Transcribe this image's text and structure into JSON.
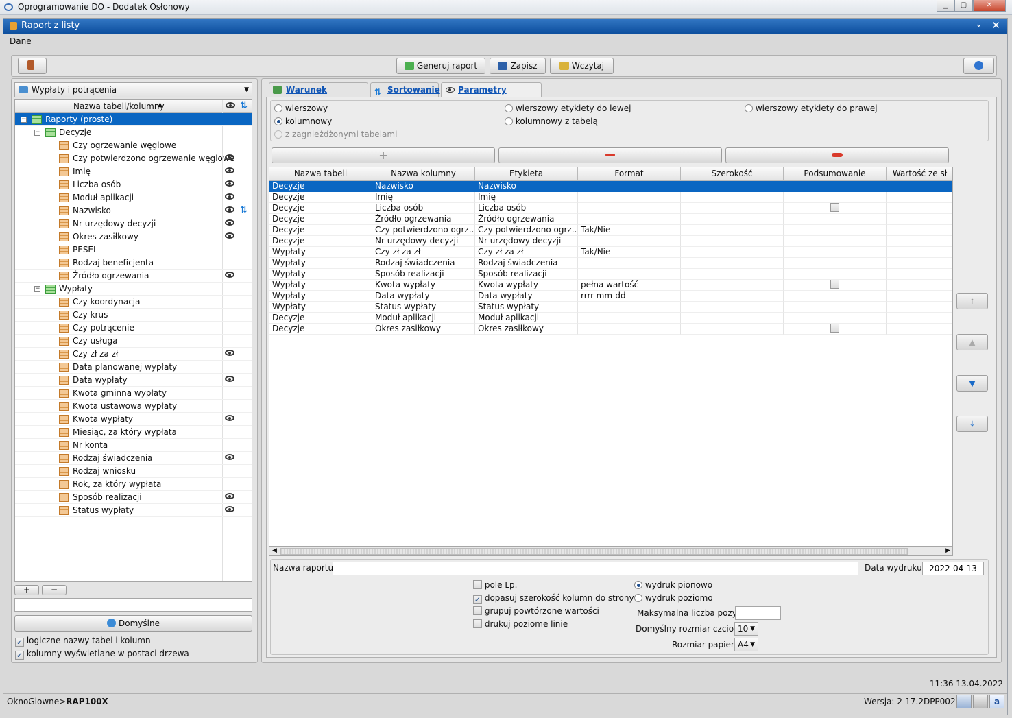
{
  "app_title": "Oprogramowanie DO - Dodatek Osłonowy",
  "window_title": "Raport z listy",
  "menu": {
    "dane": "Dane"
  },
  "toolbar": {
    "generate": "Generuj raport",
    "save": "Zapisz",
    "load": "Wczytaj"
  },
  "left": {
    "dataset": "Wypłaty i potrącenia",
    "tree_header": "Nazwa tabeli/kolumny",
    "root": "Raporty (proste)",
    "groups": [
      {
        "label": "Decyzje",
        "items": [
          {
            "label": "Czy ogrzewanie węglowe",
            "eye": false,
            "sort": false
          },
          {
            "label": "Czy potwierdzono ogrzewanie węglowe",
            "eye": true,
            "sort": false
          },
          {
            "label": "Imię",
            "eye": true,
            "sort": false
          },
          {
            "label": "Liczba osób",
            "eye": true,
            "sort": false
          },
          {
            "label": "Moduł aplikacji",
            "eye": true,
            "sort": false
          },
          {
            "label": "Nazwisko",
            "eye": true,
            "sort": true
          },
          {
            "label": "Nr urzędowy decyzji",
            "eye": true,
            "sort": false
          },
          {
            "label": "Okres zasiłkowy",
            "eye": true,
            "sort": false
          },
          {
            "label": "PESEL",
            "eye": false,
            "sort": false
          },
          {
            "label": "Rodzaj beneficjenta",
            "eye": false,
            "sort": false
          },
          {
            "label": "Źródło ogrzewania",
            "eye": true,
            "sort": false
          }
        ]
      },
      {
        "label": "Wypłaty",
        "items": [
          {
            "label": "Czy koordynacja",
            "eye": false,
            "sort": false
          },
          {
            "label": "Czy krus",
            "eye": false,
            "sort": false
          },
          {
            "label": "Czy potrącenie",
            "eye": false,
            "sort": false
          },
          {
            "label": "Czy usługa",
            "eye": false,
            "sort": false
          },
          {
            "label": "Czy zł za zł",
            "eye": true,
            "sort": false
          },
          {
            "label": "Data planowanej wypłaty",
            "eye": false,
            "sort": false
          },
          {
            "label": "Data wypłaty",
            "eye": true,
            "sort": false
          },
          {
            "label": "Kwota gminna wypłaty",
            "eye": false,
            "sort": false
          },
          {
            "label": "Kwota ustawowa wypłaty",
            "eye": false,
            "sort": false
          },
          {
            "label": "Kwota wypłaty",
            "eye": true,
            "sort": false
          },
          {
            "label": "Miesiąc, za który wypłata",
            "eye": false,
            "sort": false
          },
          {
            "label": "Nr konta",
            "eye": false,
            "sort": false
          },
          {
            "label": "Rodzaj świadczenia",
            "eye": true,
            "sort": false
          },
          {
            "label": "Rodzaj wniosku",
            "eye": false,
            "sort": false
          },
          {
            "label": "Rok, za który wypłata",
            "eye": false,
            "sort": false
          },
          {
            "label": "Sposób realizacji",
            "eye": true,
            "sort": false
          },
          {
            "label": "Status wypłaty",
            "eye": true,
            "sort": false
          }
        ]
      }
    ],
    "plus": "+",
    "minus": "−",
    "defaults_button": "Domyślne",
    "opt_logical_names": "logiczne nazwy tabel i kolumn",
    "opt_tree_columns": "kolumny wyświetlane w postaci drzewa"
  },
  "tabs": {
    "condition": "Warunek zapytania",
    "sorting": "Sortowanie",
    "params": "Parametry raportu"
  },
  "layout_options": {
    "row_plain": "wierszowy",
    "row_labels_left": "wierszowy etykiety do lewej",
    "row_labels_right": "wierszowy etykiety do prawej",
    "columnar": "kolumnowy",
    "columnar_table": "kolumnowy z tabelą",
    "nested": "z zagnieżdżonymi tabelami",
    "selected": "columnar"
  },
  "grid": {
    "headers": [
      "Nazwa tabeli",
      "Nazwa kolumny",
      "Etykieta",
      "Format",
      "Szerokość",
      "Podsumowanie",
      "Wartość ze sł"
    ],
    "rows": [
      {
        "table": "Decyzje",
        "column": "Nazwisko",
        "label": "Nazwisko",
        "format": "",
        "summary": false
      },
      {
        "table": "Decyzje",
        "column": "Imię",
        "label": "Imię",
        "format": "",
        "summary": false
      },
      {
        "table": "Decyzje",
        "column": "Liczba osób",
        "label": "Liczba osób",
        "format": "",
        "summary": true
      },
      {
        "table": "Decyzje",
        "column": "Źródło ogrzewania",
        "label": "Źródło ogrzewania",
        "format": "",
        "summary": false
      },
      {
        "table": "Decyzje",
        "column": "Czy potwierdzono ogrz...",
        "label": "Czy potwierdzono ogrz...",
        "format": "Tak/Nie",
        "summary": false
      },
      {
        "table": "Decyzje",
        "column": "Nr urzędowy decyzji",
        "label": "Nr urzędowy decyzji",
        "format": "",
        "summary": false
      },
      {
        "table": "Wypłaty",
        "column": "Czy zł za zł",
        "label": "Czy zł za zł",
        "format": "Tak/Nie",
        "summary": false
      },
      {
        "table": "Wypłaty",
        "column": "Rodzaj świadczenia",
        "label": "Rodzaj świadczenia",
        "format": "",
        "summary": false
      },
      {
        "table": "Wypłaty",
        "column": "Sposób realizacji",
        "label": "Sposób realizacji",
        "format": "",
        "summary": false
      },
      {
        "table": "Wypłaty",
        "column": "Kwota wypłaty",
        "label": "Kwota wypłaty",
        "format": "pełna wartość",
        "summary": true
      },
      {
        "table": "Wypłaty",
        "column": "Data wypłaty",
        "label": "Data wypłaty",
        "format": "rrrr-mm-dd",
        "summary": false
      },
      {
        "table": "Wypłaty",
        "column": "Status wypłaty",
        "label": "Status wypłaty",
        "format": "",
        "summary": false
      },
      {
        "table": "Decyzje",
        "column": "Moduł aplikacji",
        "label": "Moduł aplikacji",
        "format": "",
        "summary": false
      },
      {
        "table": "Decyzje",
        "column": "Okres zasiłkowy",
        "label": "Okres zasiłkowy",
        "format": "",
        "summary": true
      }
    ]
  },
  "report": {
    "name_label": "Nazwa raportu:",
    "name_value": "",
    "date_label": "Data wydruku:",
    "date_value": "2022-04-13",
    "opt_lp": "pole Lp.",
    "opt_fit": "dopasuj szerokość kolumn do strony",
    "opt_group": "grupuj powtórzone wartości",
    "opt_lines": "drukuj poziome linie",
    "portrait": "wydruk pionowo",
    "landscape": "wydruk poziomo",
    "max_label": "Maksymalna liczba pozycji:",
    "max_value": "",
    "font_label": "Domyślny rozmiar czcionki:",
    "font_value": "10",
    "paper_label": "Rozmiar papieru:",
    "paper_value": "A4"
  },
  "status": {
    "datetime": "11:36 13.04.2022",
    "path_prefix": "OknoGlowne>",
    "path_bold": "RAP100X",
    "version": "Wersja: 2-17.2DPP002"
  }
}
